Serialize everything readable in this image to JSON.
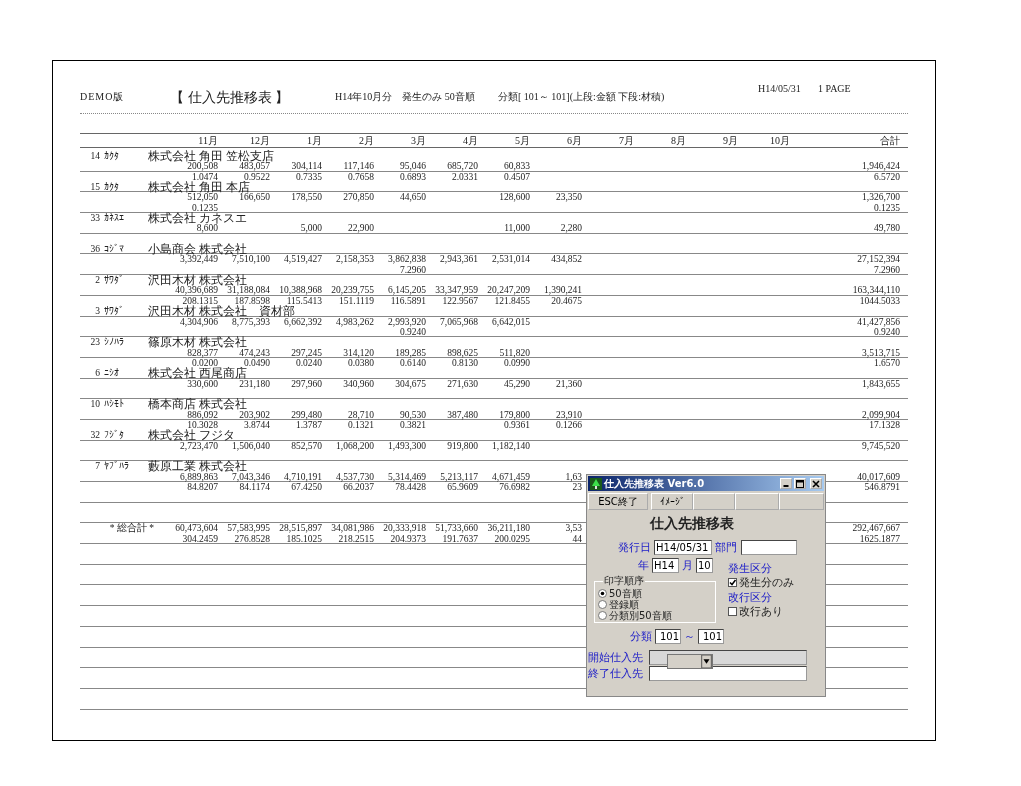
{
  "report": {
    "edition": "DEMO版",
    "title": "【 仕入先推移表 】",
    "period": "H14年10月分　発生のみ 50音順",
    "classification": "分類[ 101～ 101](上段:金額 下段:材積)",
    "date": "H14/05/31",
    "page": "1 PAGE",
    "columns": [
      "11月",
      "12月",
      "1月",
      "2月",
      "3月",
      "4月",
      "5月",
      "6月",
      "7月",
      "8月",
      "9月",
      "10月",
      "合計"
    ],
    "suppliers": [
      {
        "code": "14",
        "kana": "ｶｸﾀ",
        "name": "株式会社 角田 笠松支店",
        "amounts": {
          "nov": "200,508",
          "dec": "483,057",
          "jan": "304,114",
          "feb": "117,146",
          "mar": "95,046",
          "apr": "685,720",
          "may": "60,833",
          "total": "1,946,424"
        },
        "ratios": {
          "nov": "1.0474",
          "dec": "0.9522",
          "jan": "0.7335",
          "feb": "0.7658",
          "mar": "0.6893",
          "apr": "2.0331",
          "may": "0.4507",
          "total": "6.5720"
        }
      },
      {
        "code": "15",
        "kana": "ｶｸﾀ",
        "name": "株式会社 角田 本店",
        "amounts": {
          "nov": "512,050",
          "dec": "166,650",
          "jan": "178,550",
          "feb": "270,850",
          "mar": "44,650",
          "may": "128,600",
          "jun": "23,350",
          "total": "1,326,700"
        },
        "ratios": {
          "nov": "0.1235",
          "total": "0.1235"
        }
      },
      {
        "code": "33",
        "kana": "ｶﾈｽｴ",
        "name": "株式会社 カネスエ",
        "amounts": {
          "nov": "8,600",
          "jan": "5,000",
          "feb": "22,900",
          "may": "11,000",
          "jun": "2,280",
          "total": "49,780"
        }
      },
      {
        "code": "36",
        "kana": "ｺｼﾞﾏ",
        "name": "小島商会 株式会社",
        "amounts": {
          "nov": "3,392,449",
          "dec": "7,510,100",
          "jan": "4,519,427",
          "feb": "2,158,353",
          "mar": "3,862,838",
          "apr": "2,943,361",
          "may": "2,531,014",
          "jun": "434,852",
          "total": "27,152,394"
        },
        "ratios": {
          "mar": "7.2960",
          "total": "7.2960"
        }
      },
      {
        "code": "2",
        "kana": "ｻﾜﾀﾞ",
        "name": "沢田木材 株式会社",
        "amounts": {
          "nov": "40,396,689",
          "dec": "31,188,084",
          "jan": "10,388,968",
          "feb": "20,239,755",
          "mar": "6,145,205",
          "apr": "33,347,959",
          "may": "20,247,209",
          "jun": "1,390,241",
          "total": "163,344,110"
        },
        "ratios": {
          "nov": "208.1315",
          "dec": "187.8598",
          "jan": "115.5413",
          "feb": "151.1119",
          "mar": "116.5891",
          "apr": "122.9567",
          "may": "121.8455",
          "jun": "20.4675",
          "total": "1044.5033"
        }
      },
      {
        "code": "3",
        "kana": "ｻﾜﾀﾞ",
        "name": "沢田木材 株式会社　資材部",
        "amounts": {
          "nov": "4,304,906",
          "dec": "8,775,393",
          "jan": "6,662,392",
          "feb": "4,983,262",
          "mar": "2,993,920",
          "apr": "7,065,968",
          "may": "6,642,015",
          "total": "41,427,856"
        },
        "ratios": {
          "mar": "0.9240",
          "total": "0.9240"
        }
      },
      {
        "code": "23",
        "kana": "ｼﾉﾊﾗ",
        "name": "篠原木材 株式会社",
        "amounts": {
          "nov": "828,377",
          "dec": "474,243",
          "jan": "297,245",
          "feb": "314,120",
          "mar": "189,285",
          "apr": "898,625",
          "may": "511,820",
          "total": "3,513,715"
        },
        "ratios": {
          "nov": "0.0200",
          "dec": "0.0490",
          "jan": "0.0240",
          "feb": "0.0380",
          "mar": "0.6140",
          "apr": "0.8130",
          "may": "0.0990",
          "total": "1.6570"
        }
      },
      {
        "code": "6",
        "kana": "ﾆｼｵ",
        "name": "株式会社 西尾商店",
        "amounts": {
          "nov": "330,600",
          "dec": "231,180",
          "jan": "297,960",
          "feb": "340,960",
          "mar": "304,675",
          "apr": "271,630",
          "may": "45,290",
          "jun": "21,360",
          "total": "1,843,655"
        }
      },
      {
        "code": "10",
        "kana": "ﾊｼﾓﾄ",
        "name": "橋本商店 株式会社",
        "amounts": {
          "nov": "886,092",
          "dec": "203,902",
          "jan": "299,480",
          "feb": "28,710",
          "mar": "90,530",
          "apr": "387,480",
          "may": "179,800",
          "jun": "23,910",
          "total": "2,099,904"
        },
        "ratios": {
          "nov": "10.3028",
          "dec": "3.8744",
          "jan": "1.3787",
          "feb": "0.1321",
          "mar": "0.3821",
          "may": "0.9361",
          "jun": "0.1266",
          "total": "17.1328"
        }
      },
      {
        "code": "32",
        "kana": "ﾌｼﾞﾀ",
        "name": "株式会社 フジタ",
        "amounts": {
          "nov": "2,723,470",
          "dec": "1,506,040",
          "jan": "852,570",
          "feb": "1,068,200",
          "mar": "1,493,300",
          "apr": "919,800",
          "may": "1,182,140",
          "total": "9,745,520"
        }
      },
      {
        "code": "7",
        "kana": "ﾔﾌﾞﾊﾗ",
        "name": "藪原工業 株式会社",
        "amounts": {
          "nov": "6,889,863",
          "dec": "7,043,346",
          "jan": "4,710,191",
          "feb": "4,537,730",
          "mar": "5,314,469",
          "apr": "5,213,117",
          "may": "4,671,459",
          "jun": "1,63",
          "total": "40,017,609"
        },
        "ratios": {
          "nov": "84.8207",
          "dec": "84.1174",
          "jan": "67.4250",
          "feb": "66.2037",
          "mar": "78.4428",
          "apr": "65.9609",
          "may": "76.6982",
          "jun": "23",
          "total": "546.8791"
        }
      }
    ],
    "totals": {
      "label": "* 総合計 *",
      "amounts": {
        "nov": "60,473,604",
        "dec": "57,583,995",
        "jan": "28,515,897",
        "feb": "34,081,986",
        "mar": "20,333,918",
        "apr": "51,733,660",
        "may": "36,211,180",
        "jun": "3,53",
        "total": "292,467,667"
      },
      "ratios": {
        "nov": "304.2459",
        "dec": "276.8528",
        "jan": "185.1025",
        "feb": "218.2515",
        "mar": "204.9373",
        "apr": "191.7637",
        "may": "200.0295",
        "jun": "44",
        "total": "1625.1877"
      }
    }
  },
  "dialog": {
    "title": "仕入先推移表 Ver6.0",
    "toolbar": [
      {
        "kind": "text",
        "label": "ESC終了"
      },
      {
        "kind": "text",
        "label": "ｲﾒｰｼﾞ"
      },
      {
        "kind": "blank"
      },
      {
        "kind": "blank"
      },
      {
        "kind": "blank"
      }
    ],
    "form_title": "仕入先推移表",
    "issue_date": {
      "label": "発行日",
      "value": "H14/05/31"
    },
    "department": {
      "label": "部門"
    },
    "year": {
      "label": "年",
      "value": "H14"
    },
    "month": {
      "label": "月",
      "value": "10"
    },
    "print_order": {
      "label": "印字順序",
      "options": [
        {
          "label": "50音順",
          "selected": true
        },
        {
          "label": "登録順",
          "selected": false
        },
        {
          "label": "分類別50音順",
          "selected": false
        }
      ]
    },
    "occurrence": {
      "label": "発生区分",
      "checkbox": {
        "label": "発生分のみ",
        "checked": true
      }
    },
    "page_break": {
      "label": "改行区分",
      "checkbox": {
        "label": "改行あり",
        "checked": false
      }
    },
    "category": {
      "label": "分類",
      "from": "101",
      "separator": "～",
      "to": "101"
    },
    "start_supplier": {
      "label": "開始仕入先",
      "disabled": true
    },
    "end_supplier": {
      "label": "終了仕入先",
      "disabled": false
    }
  }
}
